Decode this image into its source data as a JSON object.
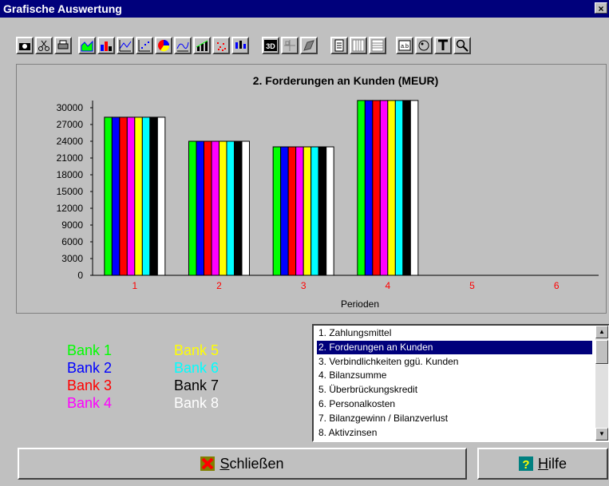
{
  "window": {
    "title": "Grafische Auswertung",
    "close_glyph": "×"
  },
  "toolbar": {
    "icons": [
      "camera-icon",
      "scissors-icon",
      "printer-icon",
      "area-chart-icon",
      "bar-chart-icon",
      "line-chart-icon",
      "scatter-chart-icon",
      "pie-chart-icon",
      "curve-chart-icon",
      "combo-chart-icon",
      "dot-chart-icon",
      "candlestick-chart-icon",
      "3d-toggle-icon",
      "grid-move-icon",
      "surface-chart-icon",
      "page-icon",
      "vertical-gridlines-icon",
      "horizontal-gridlines-icon",
      "data-labels-icon",
      "palette-icon",
      "title-tool-icon",
      "zoom-icon"
    ],
    "texts": {
      "3d": "3D",
      "labels": "a.b"
    }
  },
  "chart_data": {
    "type": "bar",
    "title": "2. Forderungen an Kunden   (MEUR)",
    "xlabel": "Perioden",
    "ylabel": "",
    "categories": [
      "1",
      "2",
      "3",
      "4",
      "5",
      "6"
    ],
    "ylim": [
      0,
      31000
    ],
    "yticks": [
      0,
      3000,
      6000,
      9000,
      12000,
      15000,
      18000,
      21000,
      24000,
      27000,
      30000
    ],
    "grid": false,
    "series": [
      {
        "name": "Bank 1",
        "color": "#00ff00",
        "values": [
          28300,
          24000,
          23000,
          31300,
          0,
          0
        ]
      },
      {
        "name": "Bank 2",
        "color": "#0000ff",
        "values": [
          28300,
          24000,
          23000,
          31300,
          0,
          0
        ]
      },
      {
        "name": "Bank 3",
        "color": "#ff0000",
        "values": [
          28300,
          24000,
          23000,
          31300,
          0,
          0
        ]
      },
      {
        "name": "Bank 4",
        "color": "#ff00ff",
        "values": [
          28300,
          24000,
          23000,
          31300,
          0,
          0
        ]
      },
      {
        "name": "Bank 5",
        "color": "#ffff00",
        "values": [
          28300,
          24000,
          23000,
          31300,
          0,
          0
        ]
      },
      {
        "name": "Bank 6",
        "color": "#00ffff",
        "values": [
          28300,
          24000,
          23000,
          31300,
          0,
          0
        ]
      },
      {
        "name": "Bank 7",
        "color": "#000000",
        "values": [
          28300,
          24000,
          23000,
          31300,
          0,
          0
        ]
      },
      {
        "name": "Bank 8",
        "color": "#ffffff",
        "values": [
          28300,
          24000,
          23000,
          31300,
          0,
          0
        ]
      }
    ],
    "tick_label_color": "#ff0000"
  },
  "legend": [
    {
      "label": "Bank 1",
      "color": "#00ff00"
    },
    {
      "label": "Bank 2",
      "color": "#0000ff"
    },
    {
      "label": "Bank 3",
      "color": "#ff0000"
    },
    {
      "label": "Bank 4",
      "color": "#ff00ff"
    },
    {
      "label": "Bank 5",
      "color": "#ffff00"
    },
    {
      "label": "Bank 6",
      "color": "#00ffff"
    },
    {
      "label": "Bank 7",
      "color": "#000000"
    },
    {
      "label": "Bank 8",
      "color": "#ffffff"
    }
  ],
  "listbox": {
    "items": [
      "1. Zahlungsmittel",
      "2. Forderungen an Kunden",
      "3. Verbindlichkeiten ggü. Kunden",
      "4. Bilanzsumme",
      "5. Überbrückungskredit",
      "6. Personalkosten",
      "7. Bilanzgewinn  /  Bilanzverlust",
      "8. Aktivzinsen"
    ],
    "selected_index": 1,
    "scroll_up": "▲",
    "scroll_down": "▼"
  },
  "buttons": {
    "close_label": "Schließen",
    "help_label": "Hilfe",
    "close_icon": "red-x-icon",
    "help_icon": "help-question-icon"
  }
}
